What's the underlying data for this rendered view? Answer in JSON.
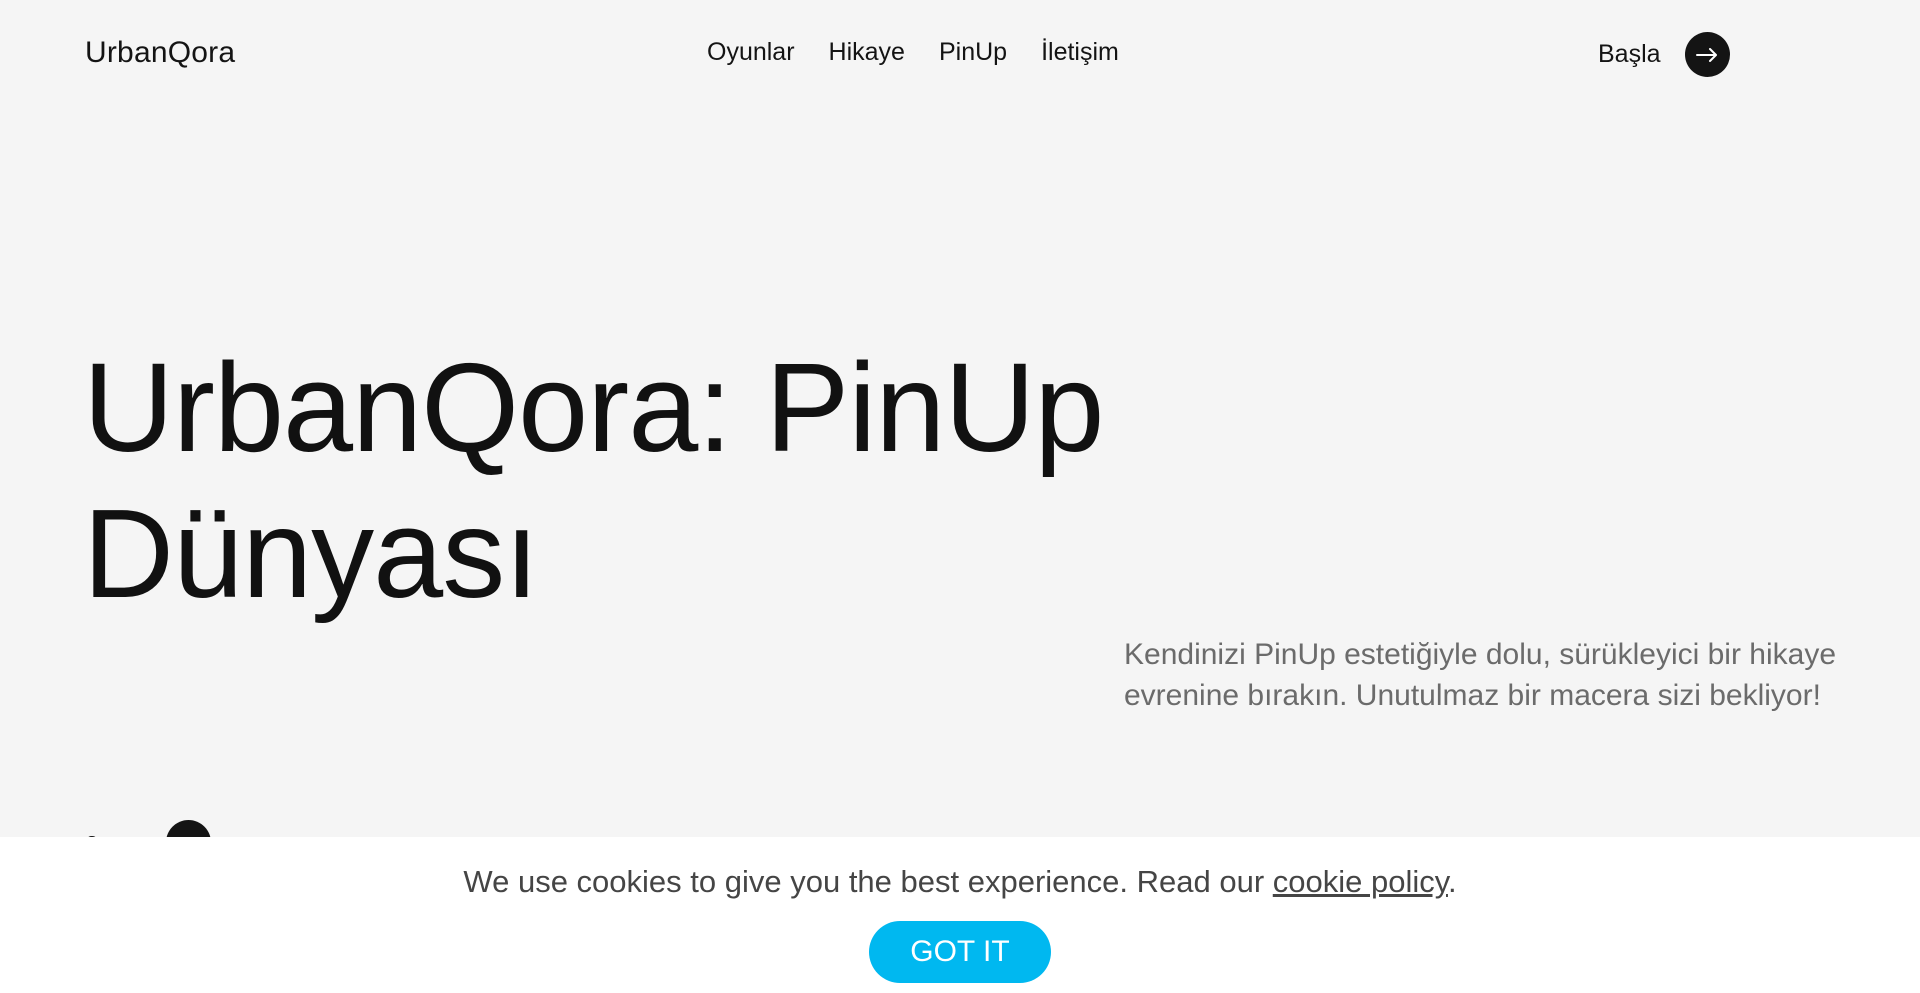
{
  "header": {
    "logo": "UrbanQora",
    "nav": [
      {
        "label": "Oyunlar"
      },
      {
        "label": "Hikaye"
      },
      {
        "label": "PinUp"
      },
      {
        "label": "İletişim"
      }
    ],
    "start_label": "Başla",
    "start_icon": "arrow-right-icon"
  },
  "hero": {
    "title_line1": "UrbanQora: PinUp",
    "title_line2": "Dünyası",
    "description": "Kendinizi PinUp estetiğiyle dolu, sürükleyici bir hikaye evrenine bırakın. Unutulmaz bir macera sizi bekliyor!",
    "partial_text": "ə"
  },
  "cookie": {
    "text_before": "We use cookies to give you the best experience. Read our ",
    "link": "cookie policy",
    "text_after": ".",
    "button": "GOT IT",
    "button_color": "#00b8f0"
  }
}
